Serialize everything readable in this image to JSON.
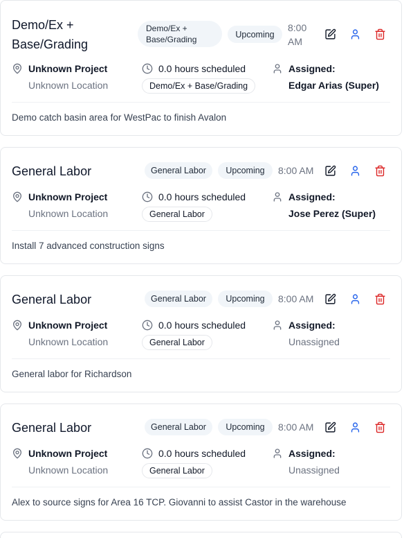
{
  "tasks": [
    {
      "title": "Demo/Ex + Base/Grading",
      "category_badge": "Demo/Ex + Base/Grading",
      "status_badge": "Upcoming",
      "time": "8:00 AM",
      "project": "Unknown Project",
      "location": "Unknown Location",
      "hours": "0.0 hours scheduled",
      "category_tag": "Demo/Ex + Base/Grading",
      "assigned_label": "Assigned:",
      "assignee": "Edgar Arias (Super)",
      "description": "Demo catch basin area for WestPac to finish Avalon"
    },
    {
      "title": "General Labor",
      "category_badge": "General Labor",
      "status_badge": "Upcoming",
      "time": "8:00 AM",
      "project": "Unknown Project",
      "location": "Unknown Location",
      "hours": "0.0 hours scheduled",
      "category_tag": "General Labor",
      "assigned_label": "Assigned:",
      "assignee": "Jose Perez (Super)",
      "description": "Install 7 advanced construction signs"
    },
    {
      "title": "General Labor",
      "category_badge": "General Labor",
      "status_badge": "Upcoming",
      "time": "8:00 AM",
      "project": "Unknown Project",
      "location": "Unknown Location",
      "hours": "0.0 hours scheduled",
      "category_tag": "General Labor",
      "assigned_label": "Assigned:",
      "assignee": "Unassigned",
      "description": "General labor for Richardson"
    },
    {
      "title": "General Labor",
      "category_badge": "General Labor",
      "status_badge": "Upcoming",
      "time": "8:00 AM",
      "project": "Unknown Project",
      "location": "Unknown Location",
      "hours": "0.0 hours scheduled",
      "category_tag": "General Labor",
      "assigned_label": "Assigned:",
      "assignee": "Unassigned",
      "description": "Alex to source signs for Area 16 TCP. Giovanni to assist Castor in the warehouse"
    }
  ],
  "icons": {
    "edit": "pencil-square-icon",
    "assign": "user-icon",
    "delete": "trash-icon",
    "location": "map-pin-icon",
    "clock": "clock-icon",
    "person": "person-icon"
  },
  "colors": {
    "assign_icon": "#2563eb",
    "delete_icon": "#dc2626",
    "edit_icon": "#111827"
  }
}
